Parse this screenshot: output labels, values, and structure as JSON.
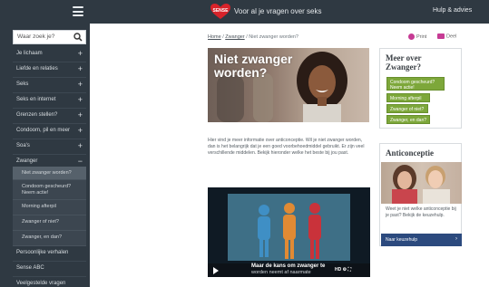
{
  "header": {
    "logo_text": "SENSE",
    "tagline": "Voor al je vragen over seks",
    "help_label": "Hulp & advies"
  },
  "search": {
    "placeholder": "Waar zoek je?"
  },
  "sidebar": {
    "items": [
      {
        "label": "Je lichaam",
        "sign": "+"
      },
      {
        "label": "Liefde en relaties",
        "sign": "+"
      },
      {
        "label": "Seks",
        "sign": "+"
      },
      {
        "label": "Seks en internet",
        "sign": "+"
      },
      {
        "label": "Grenzen stellen?",
        "sign": "+"
      },
      {
        "label": "Condoom, pil en meer",
        "sign": "+"
      },
      {
        "label": "Soa's",
        "sign": "+"
      },
      {
        "label": "Zwanger",
        "sign": "−"
      }
    ],
    "subitems": [
      {
        "label": "Niet zwanger worden?"
      },
      {
        "label": "Condoom gescheurd? Neem actie!"
      },
      {
        "label": "Morning afterpil"
      },
      {
        "label": "Zwanger of niet?"
      },
      {
        "label": "Zwanger, en dan?"
      }
    ],
    "bottom_items": [
      {
        "label": "Persoonlijke verhalen"
      },
      {
        "label": "Sense ABC"
      },
      {
        "label": "Veelgestelde vragen"
      }
    ]
  },
  "breadcrumb": {
    "home": "Home",
    "parent": "Zwanger",
    "sep": "/",
    "current": "Niet zwanger worden?"
  },
  "actions": {
    "print": "Print",
    "cart": "Deel"
  },
  "hero": {
    "title": "Niet zwanger worden?"
  },
  "body_text": "Hier vind je meer informatie over anticonceptie. Wil je niet zwanger worden, dan is het belangrijk dat je een goed voorbehoedmiddel gebruikt. Er zijn veel verschillende middelen. Bekijk hieronder welke het beste bij jou past.",
  "video": {
    "caption": "Maar de kans om zwanger te",
    "caption2": "worden neemt af naarmate"
  },
  "more_box": {
    "title": "Meer over Zwanger?",
    "buttons": [
      "Condoom gescheurd? Neem actie!",
      "Morning afterpil",
      "Zwanger of niet?",
      "Zwanger, en dan?"
    ]
  },
  "anticonceptie_box": {
    "title": "Anticonceptie",
    "text": "Weet je niet welke anticonceptie bij je past? Bekijk de keuzehulp.",
    "button": "Naar keuzehulp"
  }
}
